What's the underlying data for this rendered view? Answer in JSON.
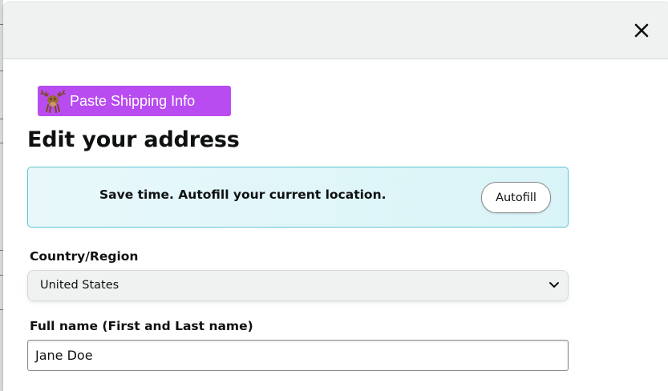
{
  "header": {
    "close_icon": "close-icon"
  },
  "extension": {
    "button_label": "Paste Shipping Info",
    "icon": "moose-icon",
    "color": "#b84cf0"
  },
  "form": {
    "title": "Edit your address",
    "autofill": {
      "message": "Save time. Autofill your current location.",
      "button_label": "Autofill"
    },
    "country": {
      "label": "Country/Region",
      "value": "United States"
    },
    "full_name": {
      "label": "Full name (First and Last name)",
      "value": "Jane Doe"
    }
  }
}
